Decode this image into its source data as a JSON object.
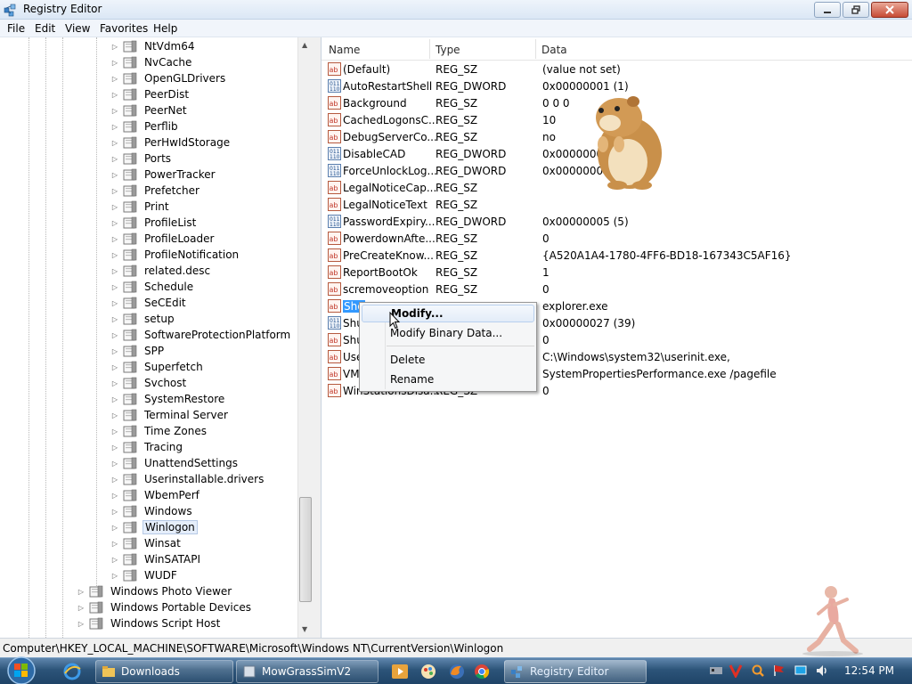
{
  "window": {
    "title": "Registry Editor",
    "menus": [
      "File",
      "Edit",
      "View",
      "Favorites",
      "Help"
    ]
  },
  "tree": {
    "items": [
      {
        "label": "NtVdm64"
      },
      {
        "label": "NvCache"
      },
      {
        "label": "OpenGLDrivers"
      },
      {
        "label": "PeerDist"
      },
      {
        "label": "PeerNet"
      },
      {
        "label": "Perflib"
      },
      {
        "label": "PerHwIdStorage"
      },
      {
        "label": "Ports"
      },
      {
        "label": "PowerTracker"
      },
      {
        "label": "Prefetcher"
      },
      {
        "label": "Print"
      },
      {
        "label": "ProfileList"
      },
      {
        "label": "ProfileLoader"
      },
      {
        "label": "ProfileNotification"
      },
      {
        "label": "related.desc"
      },
      {
        "label": "Schedule"
      },
      {
        "label": "SeCEdit"
      },
      {
        "label": "setup"
      },
      {
        "label": "SoftwareProtectionPlatform"
      },
      {
        "label": "SPP"
      },
      {
        "label": "Superfetch"
      },
      {
        "label": "Svchost"
      },
      {
        "label": "SystemRestore"
      },
      {
        "label": "Terminal Server"
      },
      {
        "label": "Time Zones"
      },
      {
        "label": "Tracing"
      },
      {
        "label": "UnattendSettings"
      },
      {
        "label": "Userinstallable.drivers"
      },
      {
        "label": "WbemPerf"
      },
      {
        "label": "Windows"
      },
      {
        "label": "Winlogon"
      },
      {
        "label": "Winsat"
      },
      {
        "label": "WinSATAPI"
      },
      {
        "label": "WUDF"
      },
      {
        "label": "Windows Photo Viewer"
      },
      {
        "label": "Windows Portable Devices"
      },
      {
        "label": "Windows Script Host"
      }
    ],
    "selected": "Winlogon"
  },
  "list": {
    "columns": [
      "Name",
      "Type",
      "Data"
    ],
    "rows": [
      {
        "name": "(Default)",
        "type": "REG_SZ",
        "data": "(value not set)",
        "icon": "string-value-icon"
      },
      {
        "name": "AutoRestartShell",
        "type": "REG_DWORD",
        "data": "0x00000001 (1)",
        "icon": "binary-value-icon"
      },
      {
        "name": "Background",
        "type": "REG_SZ",
        "data": "0 0 0",
        "icon": "string-value-icon"
      },
      {
        "name": "CachedLogonsC...",
        "type": "REG_SZ",
        "data": "10",
        "icon": "string-value-icon"
      },
      {
        "name": "DebugServerCo...",
        "type": "REG_SZ",
        "data": "no",
        "icon": "string-value-icon"
      },
      {
        "name": "DisableCAD",
        "type": "REG_DWORD",
        "data": "0x00000001 (1)",
        "icon": "binary-value-icon"
      },
      {
        "name": "ForceUnlockLog...",
        "type": "REG_DWORD",
        "data": "0x00000000 (0)",
        "icon": "binary-value-icon"
      },
      {
        "name": "LegalNoticeCap...",
        "type": "REG_SZ",
        "data": "",
        "icon": "string-value-icon"
      },
      {
        "name": "LegalNoticeText",
        "type": "REG_SZ",
        "data": "",
        "icon": "string-value-icon"
      },
      {
        "name": "PasswordExpiry...",
        "type": "REG_DWORD",
        "data": "0x00000005 (5)",
        "icon": "binary-value-icon"
      },
      {
        "name": "PowerdownAfte...",
        "type": "REG_SZ",
        "data": "0",
        "icon": "string-value-icon"
      },
      {
        "name": "PreCreateKnow...",
        "type": "REG_SZ",
        "data": "{A520A1A4-1780-4FF6-BD18-167343C5AF16}",
        "icon": "string-value-icon"
      },
      {
        "name": "ReportBootOk",
        "type": "REG_SZ",
        "data": "1",
        "icon": "string-value-icon"
      },
      {
        "name": "scremoveoption",
        "type": "REG_SZ",
        "data": "0",
        "icon": "string-value-icon"
      },
      {
        "name": "She",
        "type": "",
        "data": "explorer.exe",
        "icon": "string-value-icon"
      },
      {
        "name": "Shu",
        "type": "",
        "data": "0x00000027 (39)",
        "icon": "binary-value-icon"
      },
      {
        "name": "Shu",
        "type": "",
        "data": "0",
        "icon": "string-value-icon"
      },
      {
        "name": "Use",
        "type": "",
        "data": "C:\\Windows\\system32\\userinit.exe,",
        "icon": "string-value-icon"
      },
      {
        "name": "VMA",
        "type": "",
        "data": "SystemPropertiesPerformance.exe /pagefile",
        "icon": "string-value-icon"
      },
      {
        "name": "WinStationsDisa...",
        "type": "REG_SZ",
        "data": "0",
        "icon": "string-value-icon"
      }
    ],
    "selected_index": 14
  },
  "context_menu": {
    "items": [
      "Modify...",
      "Modify Binary Data...",
      "Delete",
      "Rename"
    ]
  },
  "status": {
    "path": "Computer\\HKEY_LOCAL_MACHINE\\SOFTWARE\\Microsoft\\Windows NT\\CurrentVersion\\Winlogon"
  },
  "taskbar": {
    "buttons": [
      "Downloads",
      "MowGrassSimV2",
      "Registry Editor"
    ],
    "clock": "12:54 PM"
  },
  "colors": {
    "selection": "#3399ff",
    "taskbar": "#1f4467"
  }
}
